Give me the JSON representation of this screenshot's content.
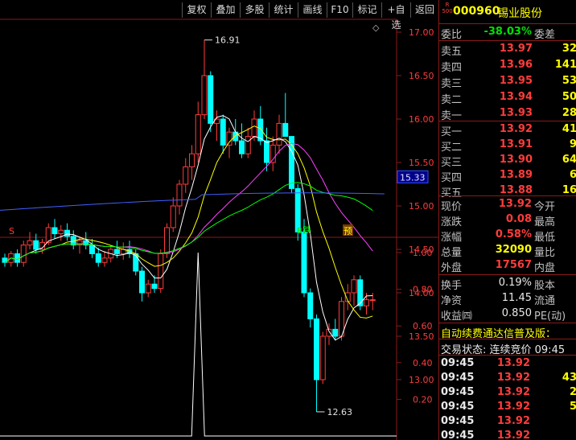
{
  "toolbar": [
    "复权",
    "叠加",
    "多股",
    "统计",
    "画线",
    "F10",
    "标记",
    "+自选",
    "返回"
  ],
  "chart": {
    "price_axis": [
      "17.00",
      "16.50",
      "16.00",
      "15.50",
      "15.00",
      "14.50",
      "14.00",
      "13.50",
      "13.00"
    ],
    "current_price_tag": "15.33",
    "high_label": "16.91",
    "low_label": "12.63",
    "marker_fall": "跌",
    "marker_b": "B",
    "marker_pre": "预",
    "marker_s": "S",
    "diamond": "◇",
    "ind_axis": [
      "1.00",
      "0.80",
      "0.60",
      "0.40",
      "0.20"
    ],
    "colors": {
      "up": "#ff3c3c",
      "down": "#00ffff",
      "ma5": "#ffffff",
      "ma10": "#ffff00",
      "ma20": "#ff40ff",
      "ma30": "#00ff00",
      "ma60": "#4060ff",
      "grid": "#8a1a1a"
    },
    "candles": [
      [
        14.4,
        14.45,
        14.3,
        14.35
      ],
      [
        14.35,
        14.48,
        14.3,
        14.45
      ],
      [
        14.45,
        14.5,
        14.3,
        14.35
      ],
      [
        14.35,
        14.6,
        14.3,
        14.55
      ],
      [
        14.55,
        14.7,
        14.5,
        14.6
      ],
      [
        14.6,
        14.68,
        14.45,
        14.5
      ],
      [
        14.5,
        14.62,
        14.45,
        14.58
      ],
      [
        14.58,
        14.8,
        14.55,
        14.75
      ],
      [
        14.75,
        14.85,
        14.62,
        14.68
      ],
      [
        14.68,
        14.78,
        14.6,
        14.72
      ],
      [
        14.72,
        14.8,
        14.6,
        14.65
      ],
      [
        14.65,
        14.72,
        14.5,
        14.55
      ],
      [
        14.55,
        14.65,
        14.45,
        14.6
      ],
      [
        14.6,
        14.7,
        14.5,
        14.55
      ],
      [
        14.55,
        14.62,
        14.4,
        14.45
      ],
      [
        14.45,
        14.52,
        14.3,
        14.35
      ],
      [
        14.35,
        14.48,
        14.3,
        14.4
      ],
      [
        14.4,
        14.55,
        14.35,
        14.5
      ],
      [
        14.5,
        14.6,
        14.4,
        14.45
      ],
      [
        14.45,
        14.58,
        14.38,
        14.5
      ],
      [
        14.5,
        14.6,
        14.4,
        14.45
      ],
      [
        14.45,
        14.5,
        14.2,
        14.25
      ],
      [
        14.25,
        14.3,
        13.9,
        14.0
      ],
      [
        14.0,
        14.15,
        13.95,
        14.1
      ],
      [
        14.1,
        14.2,
        14.0,
        14.05
      ],
      [
        14.05,
        14.5,
        14.0,
        14.45
      ],
      [
        14.45,
        14.8,
        14.4,
        14.75
      ],
      [
        14.75,
        15.1,
        14.7,
        15.0
      ],
      [
        15.0,
        15.3,
        14.9,
        15.25
      ],
      [
        15.25,
        15.55,
        15.15,
        15.45
      ],
      [
        15.45,
        15.7,
        15.3,
        15.6
      ],
      [
        15.6,
        16.2,
        15.5,
        16.05
      ],
      [
        16.05,
        16.91,
        16.0,
        16.5
      ],
      [
        16.5,
        16.55,
        15.85,
        15.95
      ],
      [
        15.95,
        16.1,
        15.75,
        16.0
      ],
      [
        16.0,
        16.05,
        15.6,
        15.7
      ],
      [
        15.7,
        15.9,
        15.55,
        15.85
      ],
      [
        15.85,
        16.0,
        15.7,
        15.75
      ],
      [
        15.75,
        15.95,
        15.55,
        15.6
      ],
      [
        15.6,
        15.9,
        15.55,
        15.8
      ],
      [
        15.8,
        16.1,
        15.75,
        16.0
      ],
      [
        16.0,
        16.15,
        15.7,
        15.75
      ],
      [
        15.75,
        15.9,
        15.4,
        15.5
      ],
      [
        15.5,
        15.8,
        15.4,
        15.7
      ],
      [
        15.7,
        16.05,
        15.6,
        15.95
      ],
      [
        15.95,
        16.3,
        15.8,
        15.8
      ],
      [
        15.8,
        15.7,
        15.15,
        15.2
      ],
      [
        15.2,
        15.25,
        14.6,
        14.7
      ],
      [
        14.7,
        14.85,
        13.95,
        14.0
      ],
      [
        14.0,
        14.05,
        13.6,
        13.7
      ],
      [
        13.7,
        13.75,
        12.63,
        13.0
      ],
      [
        13.0,
        13.55,
        12.95,
        13.5
      ],
      [
        13.5,
        13.65,
        13.4,
        13.58
      ],
      [
        13.58,
        13.7,
        13.45,
        13.5
      ],
      [
        13.5,
        13.95,
        13.45,
        13.9
      ],
      [
        13.9,
        14.1,
        13.8,
        14.0
      ],
      [
        14.0,
        14.2,
        13.85,
        14.15
      ],
      [
        14.15,
        14.2,
        13.8,
        13.85
      ],
      [
        13.85,
        14.0,
        13.75,
        13.92
      ],
      [
        13.92,
        14.0,
        13.8,
        13.92
      ]
    ],
    "indicator_peak_index": 31
  },
  "quote": {
    "code_badge_top": "R",
    "code_badge_bottom": "500",
    "code": "000960",
    "name": "锡业股份",
    "weibi_label": "委比",
    "weibi_value": "-38.03%",
    "weicha_label": "委差",
    "asks": [
      {
        "label": "卖五",
        "price": "13.97",
        "vol": "32"
      },
      {
        "label": "卖四",
        "price": "13.96",
        "vol": "141"
      },
      {
        "label": "卖三",
        "price": "13.95",
        "vol": "53"
      },
      {
        "label": "卖二",
        "price": "13.94",
        "vol": "50"
      },
      {
        "label": "卖一",
        "price": "13.93",
        "vol": "28"
      }
    ],
    "bids": [
      {
        "label": "买一",
        "price": "13.92",
        "vol": "41"
      },
      {
        "label": "买二",
        "price": "13.91",
        "vol": "9"
      },
      {
        "label": "买三",
        "price": "13.90",
        "vol": "64"
      },
      {
        "label": "买四",
        "price": "13.89",
        "vol": "6"
      },
      {
        "label": "买五",
        "price": "13.88",
        "vol": "16"
      }
    ],
    "stats": [
      {
        "l1": "现价",
        "v1": "13.92",
        "c1": "red",
        "l2": "今开"
      },
      {
        "l1": "涨跌",
        "v1": "0.08",
        "c1": "red",
        "l2": "最高"
      },
      {
        "l1": "涨幅",
        "v1": "0.58%",
        "c1": "red",
        "l2": "最低"
      },
      {
        "l1": "总量",
        "v1": "32090",
        "c1": "yellow",
        "l2": "量比"
      },
      {
        "l1": "外盘",
        "v1": "17567",
        "c1": "red",
        "l2": "内盘"
      }
    ],
    "stats2": [
      {
        "l1": "换手",
        "v1": "0.19%",
        "l2": "股本"
      },
      {
        "l1": "净资",
        "v1": "11.45",
        "l2": "流通"
      },
      {
        "l1": "收益㈣",
        "v1": "0.850",
        "l2": "PE(动)"
      }
    ],
    "banner": "自动续费通达信普及版：",
    "trade_status": "交易状态: 连续竞价 09:45",
    "ticks": [
      {
        "time": "09:45",
        "price": "13.92",
        "vol": ""
      },
      {
        "time": "09:45",
        "price": "13.92",
        "vol": "43"
      },
      {
        "time": "09:45",
        "price": "13.92",
        "vol": "2"
      },
      {
        "time": "09:45",
        "price": "13.92",
        "vol": "5"
      },
      {
        "time": "09:45",
        "price": "13.92",
        "vol": ""
      },
      {
        "time": "09:45",
        "price": "13.92",
        "vol": ""
      }
    ]
  }
}
